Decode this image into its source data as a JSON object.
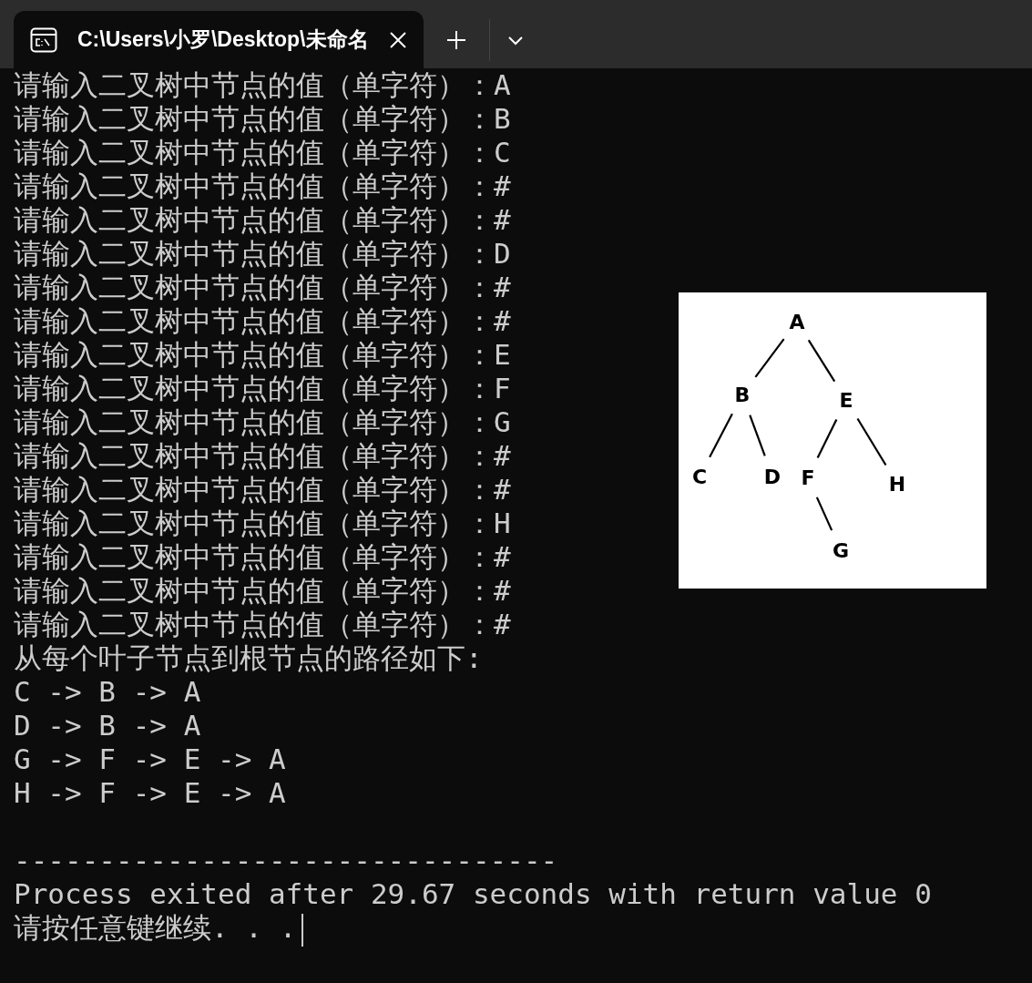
{
  "window": {
    "tab": {
      "title": "C:\\Users\\小罗\\Desktop\\未命名",
      "selected": true
    }
  },
  "terminal": {
    "blocks": [
      [
        "请输入二叉树中节点的值（单字符）：A",
        "请输入二叉树中节点的值（单字符）：B",
        "请输入二叉树中节点的值（单字符）：C",
        "请输入二叉树中节点的值（单字符）：#",
        "请输入二叉树中节点的值（单字符）：#",
        "请输入二叉树中节点的值（单字符）：D",
        "请输入二叉树中节点的值（单字符）：#",
        "请输入二叉树中节点的值（单字符）：#",
        "请输入二叉树中节点的值（单字符）：E",
        "请输入二叉树中节点的值（单字符）：F",
        "请输入二叉树中节点的值（单字符）：G",
        "请输入二叉树中节点的值（单字符）：#",
        "请输入二叉树中节点的值（单字符）：#",
        "请输入二叉树中节点的值（单字符）：H",
        "请输入二叉树中节点的值（单字符）：#",
        "请输入二叉树中节点的值（单字符）：#",
        "请输入二叉树中节点的值（单字符）：#",
        "从每个叶子节点到根节点的路径如下:",
        "C -> B -> A",
        "D -> B -> A",
        "G -> F -> E -> A",
        "H -> F -> E -> A"
      ],
      [
        "--------------------------------",
        "Process exited after 29.67 seconds with return value 0",
        "请按任意键继续. . ."
      ]
    ],
    "cursor_visible": true
  },
  "tree_image": {
    "root": {
      "label": "A",
      "children": [
        {
          "label": "B",
          "children": [
            {
              "label": "C"
            },
            {
              "label": "D"
            }
          ]
        },
        {
          "label": "E",
          "children": [
            {
              "label": "F",
              "children": [
                {
                  "label": "G"
                }
              ]
            },
            {
              "label": "H"
            }
          ]
        }
      ]
    }
  }
}
